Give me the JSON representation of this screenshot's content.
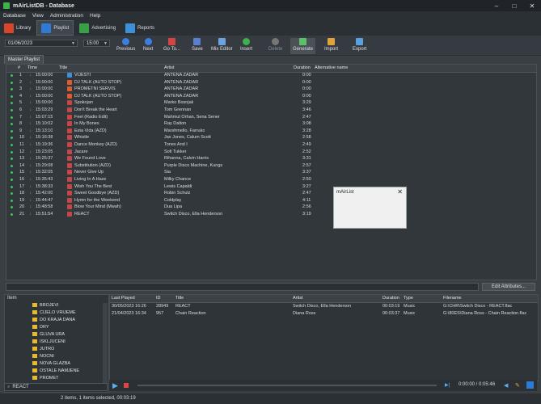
{
  "window": {
    "title": "mAirListDB - Database"
  },
  "menu": [
    "Database",
    "View",
    "Administration",
    "Help"
  ],
  "tabs": [
    {
      "label": "Library",
      "icon": "library-icon",
      "color": "#d9452b"
    },
    {
      "label": "Playlist",
      "icon": "playlist-icon",
      "color": "#2d7bd6"
    },
    {
      "label": "Advertising",
      "icon": "advertising-icon",
      "color": "#3aa047"
    },
    {
      "label": "Reports",
      "icon": "reports-icon",
      "color": "#3d8fd8"
    }
  ],
  "toolbar": {
    "date": "01/06/2023",
    "hour": "15:00",
    "buttons": [
      {
        "label": "Previous",
        "icon": "previous-icon",
        "color": "#3b7fe0"
      },
      {
        "label": "Next",
        "icon": "next-icon",
        "color": "#3b7fe0"
      },
      {
        "label": "Go To...",
        "icon": "calendar-icon",
        "color": "#d34545"
      },
      {
        "label": "Save",
        "icon": "save-icon",
        "color": "#5a7fcf"
      },
      {
        "label": "Mix Editor",
        "icon": "mix-editor-icon",
        "color": "#6aa3e0"
      },
      {
        "label": "Insert",
        "icon": "insert-icon",
        "color": "#3bb34a"
      },
      {
        "label": "Delete",
        "icon": "delete-icon",
        "color": "#777"
      },
      {
        "label": "Generate",
        "icon": "generate-icon",
        "color": "#5cc06a"
      },
      {
        "label": "Import",
        "icon": "import-icon",
        "color": "#e0a23a"
      },
      {
        "label": "Export",
        "icon": "export-icon",
        "color": "#5aa0e0"
      }
    ]
  },
  "playlist_tab": "Master Playlist",
  "grid": {
    "columns": [
      "#",
      "Time",
      "Title",
      "Artist",
      "Duration",
      "Alternative name"
    ],
    "rows": [
      {
        "n": "1",
        "time": "15:00:00",
        "title": "VIJESTI",
        "artist": "ANTENA ZADAR",
        "dur": "0:00",
        "type": "info"
      },
      {
        "n": "2",
        "time": "15:00:00",
        "title": "DJ TALK (AUTO STOP)",
        "artist": "ANTENA ZADAR",
        "dur": "0:00",
        "type": "mic"
      },
      {
        "n": "3",
        "time": "15:00:00",
        "title": "PROMETNI SERVIS",
        "artist": "ANTENA ZADAR",
        "dur": "0:00",
        "type": "mic"
      },
      {
        "n": "4",
        "time": "15:00:00",
        "title": "DJ TALK (AUTO STOP)",
        "artist": "ANTENA ZADAR",
        "dur": "0:00",
        "type": "mic"
      },
      {
        "n": "5",
        "time": "15:00:00",
        "title": "Spokojan",
        "artist": "Marko Bosnjak",
        "dur": "3:29",
        "type": "music"
      },
      {
        "n": "6",
        "time": "15:03:29",
        "title": "Don't Break the Heart",
        "artist": "Tom Grennan",
        "dur": "3:46",
        "type": "music"
      },
      {
        "n": "7",
        "time": "15:07:15",
        "title": "Feel (Radio Edit)",
        "artist": "Mahmut Orhan, Sena Sener",
        "dur": "2:47",
        "type": "music"
      },
      {
        "n": "8",
        "time": "15:10:02",
        "title": "In My Bones",
        "artist": "Ray Dalton",
        "dur": "3:08",
        "type": "music"
      },
      {
        "n": "9",
        "time": "15:13:10",
        "title": "Esta Vida (AZD)",
        "artist": "Marshmello, Farruko",
        "dur": "3:28",
        "type": "music"
      },
      {
        "n": "10",
        "time": "15:16:38",
        "title": "Whistle",
        "artist": "Jax Jones, Calum Scott",
        "dur": "2:58",
        "type": "music"
      },
      {
        "n": "11",
        "time": "15:19:36",
        "title": "Dance Monkey (AZD)",
        "artist": "Tones And I",
        "dur": "2:49",
        "type": "music"
      },
      {
        "n": "12",
        "time": "15:23:05",
        "title": "Jacare",
        "artist": "Sofi Tukker",
        "dur": "2:52",
        "type": "music"
      },
      {
        "n": "13",
        "time": "15:25:37",
        "title": "We Found Love",
        "artist": "Rihanna, Calvin Harris",
        "dur": "3:31",
        "type": "music"
      },
      {
        "n": "14",
        "time": "15:29:08",
        "title": "Substitution (AZD)",
        "artist": "Purple Disco Machine, Kungs",
        "dur": "2:57",
        "type": "music"
      },
      {
        "n": "15",
        "time": "15:32:05",
        "title": "Never Give Up",
        "artist": "Sia",
        "dur": "3:37",
        "type": "music"
      },
      {
        "n": "16",
        "time": "15:35:43",
        "title": "Living In A Haze",
        "artist": "Milky Chance",
        "dur": "2:50",
        "type": "music"
      },
      {
        "n": "17",
        "time": "15:38:33",
        "title": "Wish You The Best",
        "artist": "Lewis Capaldi",
        "dur": "3:27",
        "type": "music"
      },
      {
        "n": "18",
        "time": "15:42:00",
        "title": "Sweet Goodbye (AZD)",
        "artist": "Robin Schulz",
        "dur": "2:47",
        "type": "music"
      },
      {
        "n": "19",
        "time": "15:44:47",
        "title": "Hymn for the Weekend",
        "artist": "Coldplay",
        "dur": "4:11",
        "type": "music"
      },
      {
        "n": "20",
        "time": "15:48:58",
        "title": "Blow Your Mind (Mwah)",
        "artist": "Dua Lipa",
        "dur": "2:56",
        "type": "music"
      },
      {
        "n": "21",
        "time": "15:51:54",
        "title": "REACT",
        "artist": "Switch Disco, Ella Henderson",
        "dur": "3:19",
        "type": "music"
      }
    ]
  },
  "popup": {
    "title": "mAirList"
  },
  "edit_attributes": "Edit Attributes...",
  "tree": {
    "header": "Item",
    "folders": [
      "BROJEVI",
      "CIJELO VRIJEME",
      "DO KRAJA DANA",
      "DRY",
      "GLUVA URA",
      "ISKLJUCENI",
      "JUTRO",
      "NOCNI",
      "NOVA GLAZBA",
      "OSTALE NAMJENE",
      "PROMET",
      "RADNI DAN"
    ]
  },
  "search": {
    "value": "REACT"
  },
  "results": {
    "columns": [
      "Last Played",
      "ID",
      "Title",
      "Artist",
      "Duration",
      "Type",
      "Filename"
    ],
    "rows": [
      {
        "last": "30/05/2023 16:26",
        "id": "28949",
        "title": "REACT",
        "artist": "Switch Disco, Ella Henderson",
        "dur": "00:03:19",
        "type": "Music",
        "file": "G:\\CHR\\Switch Disco - REACT.flac"
      },
      {
        "last": "21/04/2023 16:34",
        "id": "957",
        "title": "Chain Reaction",
        "artist": "Diana Ross",
        "dur": "00:03:37",
        "type": "Music",
        "file": "G:\\80ES\\Diana Ross - Chain Reaction.flac"
      }
    ]
  },
  "player": {
    "time": "0:00:00 / 0:05:46"
  },
  "status": {
    "text": "2 items, 1 items selected, 00:03:19"
  }
}
